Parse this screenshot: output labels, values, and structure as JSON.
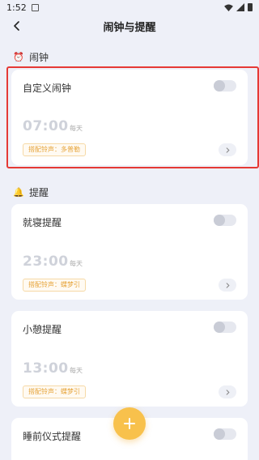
{
  "status": {
    "time": "1:52"
  },
  "nav": {
    "title": "闹钟与提醒"
  },
  "sections": {
    "alarm": {
      "icon": "alarm-clock-icon",
      "label": "闹钟"
    },
    "reminder": {
      "icon": "bell-icon",
      "label": "提醒"
    }
  },
  "cards": [
    {
      "title": "自定义闹钟",
      "time": "07:00",
      "repeat": "每天",
      "ringtone": "搭配铃声：多普勒",
      "enabled": false
    },
    {
      "title": "就寝提醒",
      "time": "23:00",
      "repeat": "每天",
      "ringtone": "搭配铃声：蝶梦引",
      "enabled": false
    },
    {
      "title": "小憩提醒",
      "time": "13:00",
      "repeat": "每天",
      "ringtone": "搭配铃声：蝶梦引",
      "enabled": false
    },
    {
      "title": "睡前仪式提醒",
      "enabled": false
    }
  ],
  "colors": {
    "background": "#eef0f8",
    "accent": "#f8c14c",
    "highlight": "#e53935"
  }
}
